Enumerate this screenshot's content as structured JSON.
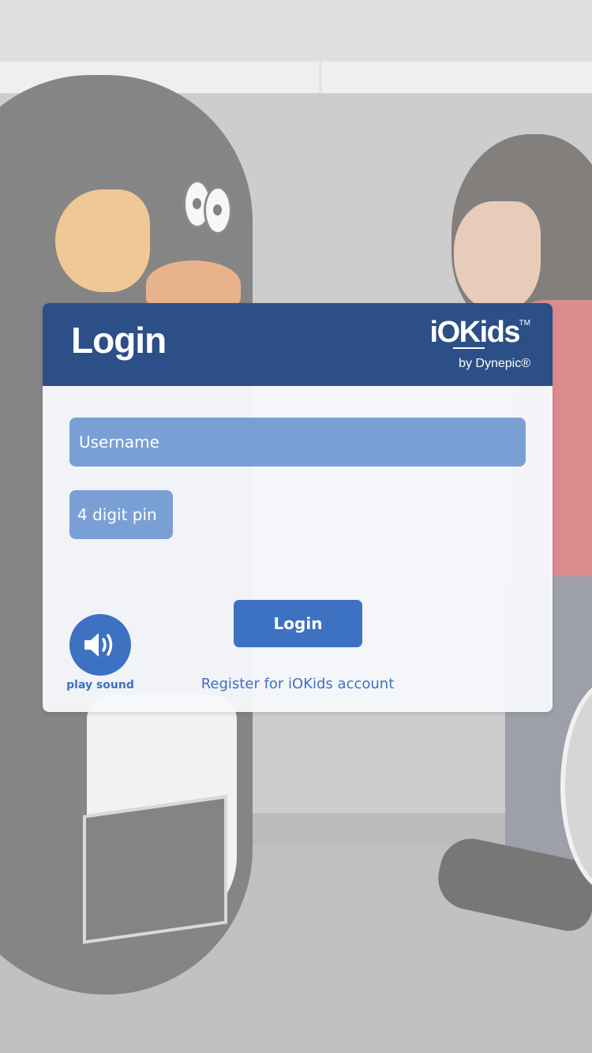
{
  "login_card": {
    "title": "Login",
    "logo": {
      "name": "iOKids",
      "trademark": "TM",
      "byline": "by Dynepic®"
    },
    "username_field": {
      "placeholder": "Username",
      "value": ""
    },
    "pin_field": {
      "placeholder": "4 digit pin",
      "value": ""
    },
    "login_button_label": "Login",
    "play_sound": {
      "icon": "speaker-icon",
      "label": "play sound"
    },
    "register_link": "Register for iOKids account"
  },
  "colors": {
    "header": "#2b4f86",
    "accent": "#3d71c1",
    "field": "#7a9fd5"
  }
}
